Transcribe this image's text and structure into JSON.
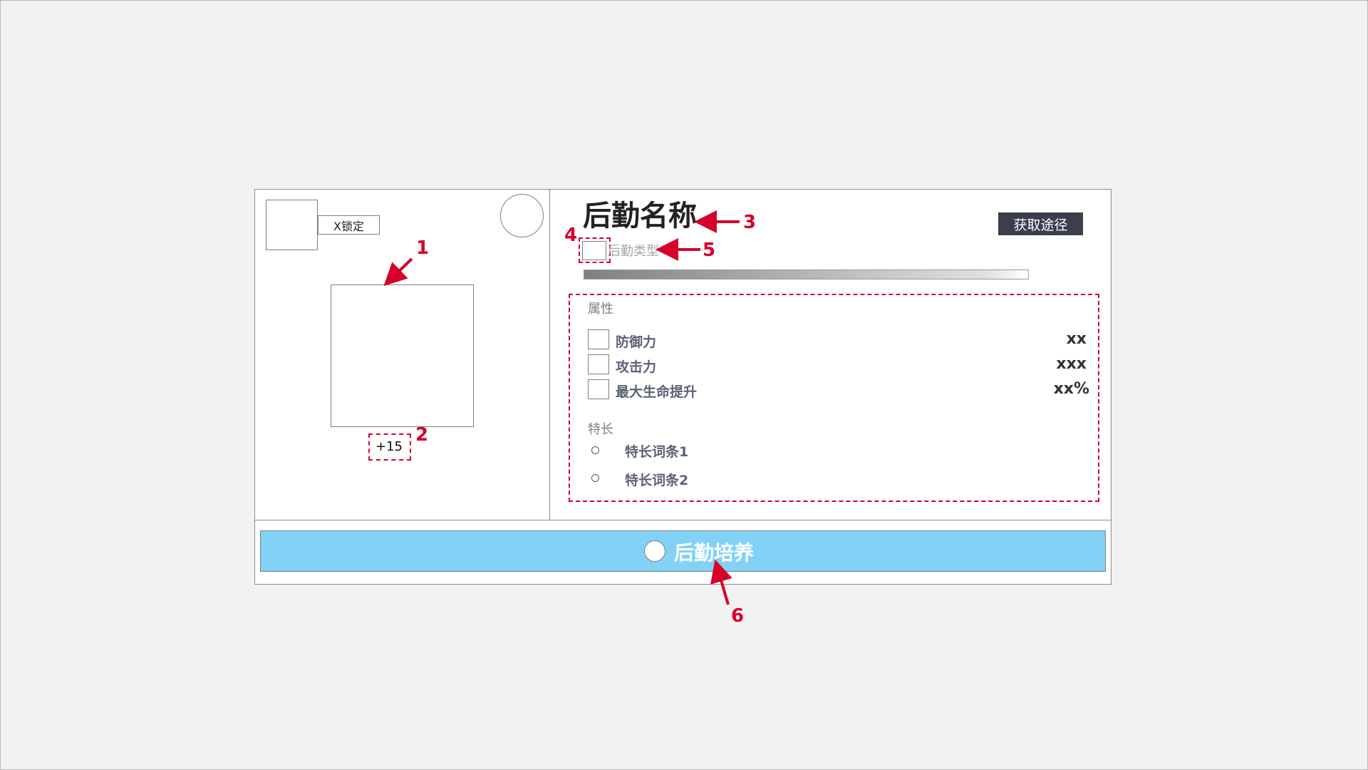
{
  "item": {
    "lock_label": "X锁定",
    "level": "+15",
    "name": "后勤名称",
    "type": "后勤类型",
    "acquire_button": "获取途径",
    "progress": 1.0
  },
  "attributes": {
    "section_label": "属性",
    "rows": [
      {
        "name": "防御力",
        "value": "xx"
      },
      {
        "name": "攻击力",
        "value": "xxx"
      },
      {
        "name": "最大生命提升",
        "value": "xx%"
      }
    ]
  },
  "specialties": {
    "section_label": "特长",
    "items": [
      {
        "name": "特长词条1"
      },
      {
        "name": "特长词条2"
      }
    ]
  },
  "train_button": {
    "label": "后勤培养"
  },
  "annotations": {
    "n1": "1",
    "n2": "2",
    "n3": "3",
    "n4": "4",
    "n5": "5",
    "n6": "6",
    "color": "#d6002a"
  },
  "colors": {
    "train_button": "#82d2f7",
    "acquire_button": "#3a3f4b",
    "annotation": "#d6002a"
  }
}
